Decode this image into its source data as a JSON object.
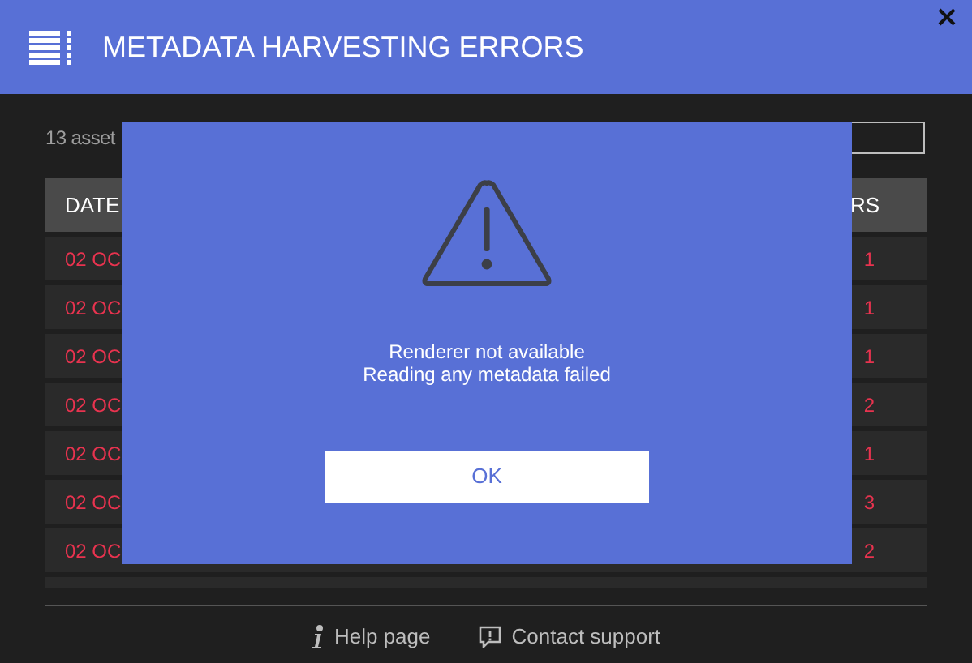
{
  "window": {
    "title": "METADATA HARVESTING ERRORS"
  },
  "summary": "13 asset",
  "table": {
    "columns": [
      "DATE",
      "RS"
    ],
    "rows": [
      {
        "date": "02 OC",
        "errors": "1"
      },
      {
        "date": "02 OC",
        "errors": "1"
      },
      {
        "date": "02 OC",
        "errors": "1"
      },
      {
        "date": "02 OC",
        "errors": "2"
      },
      {
        "date": "02 OC",
        "errors": "1"
      },
      {
        "date": "02 OC",
        "errors": "3"
      },
      {
        "date": "02 OC",
        "errors": "2"
      }
    ]
  },
  "footer": {
    "links": [
      {
        "kind": "help",
        "label": "Help page"
      },
      {
        "kind": "support",
        "label": "Contact support"
      }
    ]
  },
  "dialog": {
    "lines": [
      "Renderer not available",
      "Reading any metadata failed"
    ],
    "button": "OK"
  }
}
